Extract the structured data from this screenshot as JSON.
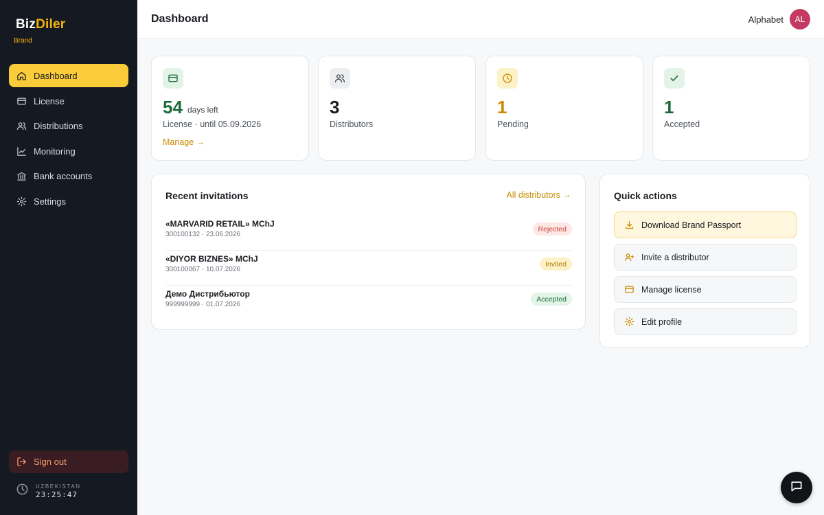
{
  "brand": {
    "name_part1": "Biz",
    "name_part2": "Diler",
    "subtitle": "Brand"
  },
  "sidebar": {
    "items": [
      {
        "label": "Dashboard",
        "icon": "home-icon",
        "active": true
      },
      {
        "label": "License",
        "icon": "credit-card-icon"
      },
      {
        "label": "Distributions",
        "icon": "users-icon"
      },
      {
        "label": "Monitoring",
        "icon": "chart-line-icon"
      },
      {
        "label": "Bank accounts",
        "icon": "bank-icon"
      },
      {
        "label": "Settings",
        "icon": "gear-icon"
      }
    ],
    "signout_label": "Sign out",
    "clock": {
      "region": "UZBEKISTAN",
      "time": "23:25:47"
    }
  },
  "header": {
    "title": "Dashboard",
    "org": "Alphabet",
    "avatar_initials": "AL"
  },
  "stats": {
    "license": {
      "value": "54",
      "suffix": "days left",
      "label": "License · until 05.09.2026",
      "link": "Manage →"
    },
    "distributors": {
      "value": "3",
      "label": "Distributors"
    },
    "pending": {
      "value": "1",
      "label": "Pending"
    },
    "accepted": {
      "value": "1",
      "label": "Accepted"
    }
  },
  "invitations": {
    "title": "Recent invitations",
    "all_link": "All distributors →",
    "rows": [
      {
        "name": "«MARVARID RETAIL» MChJ",
        "meta": "300100132 · 23.06.2026",
        "status": "Rejected"
      },
      {
        "name": "«DIYOR BIZNES» MChJ",
        "meta": "300100067 · 10.07.2026",
        "status": "Invited"
      },
      {
        "name": "Демо Дистрибьютор",
        "meta": "999999999 · 01.07.2026",
        "status": "Accepted"
      }
    ]
  },
  "quick_actions": {
    "title": "Quick actions",
    "items": [
      {
        "label": "Download Brand Passport",
        "icon": "download-icon"
      },
      {
        "label": "Invite a distributor",
        "icon": "user-plus-icon"
      },
      {
        "label": "Manage license",
        "icon": "credit-card-icon"
      },
      {
        "label": "Edit profile",
        "icon": "gear-icon"
      }
    ]
  },
  "colors": {
    "accent": "#fbcc3a",
    "sidebar_bg": "#151a22",
    "green": "#1d6b3b",
    "amber": "#c98c00",
    "avatar": "#c43a63"
  }
}
